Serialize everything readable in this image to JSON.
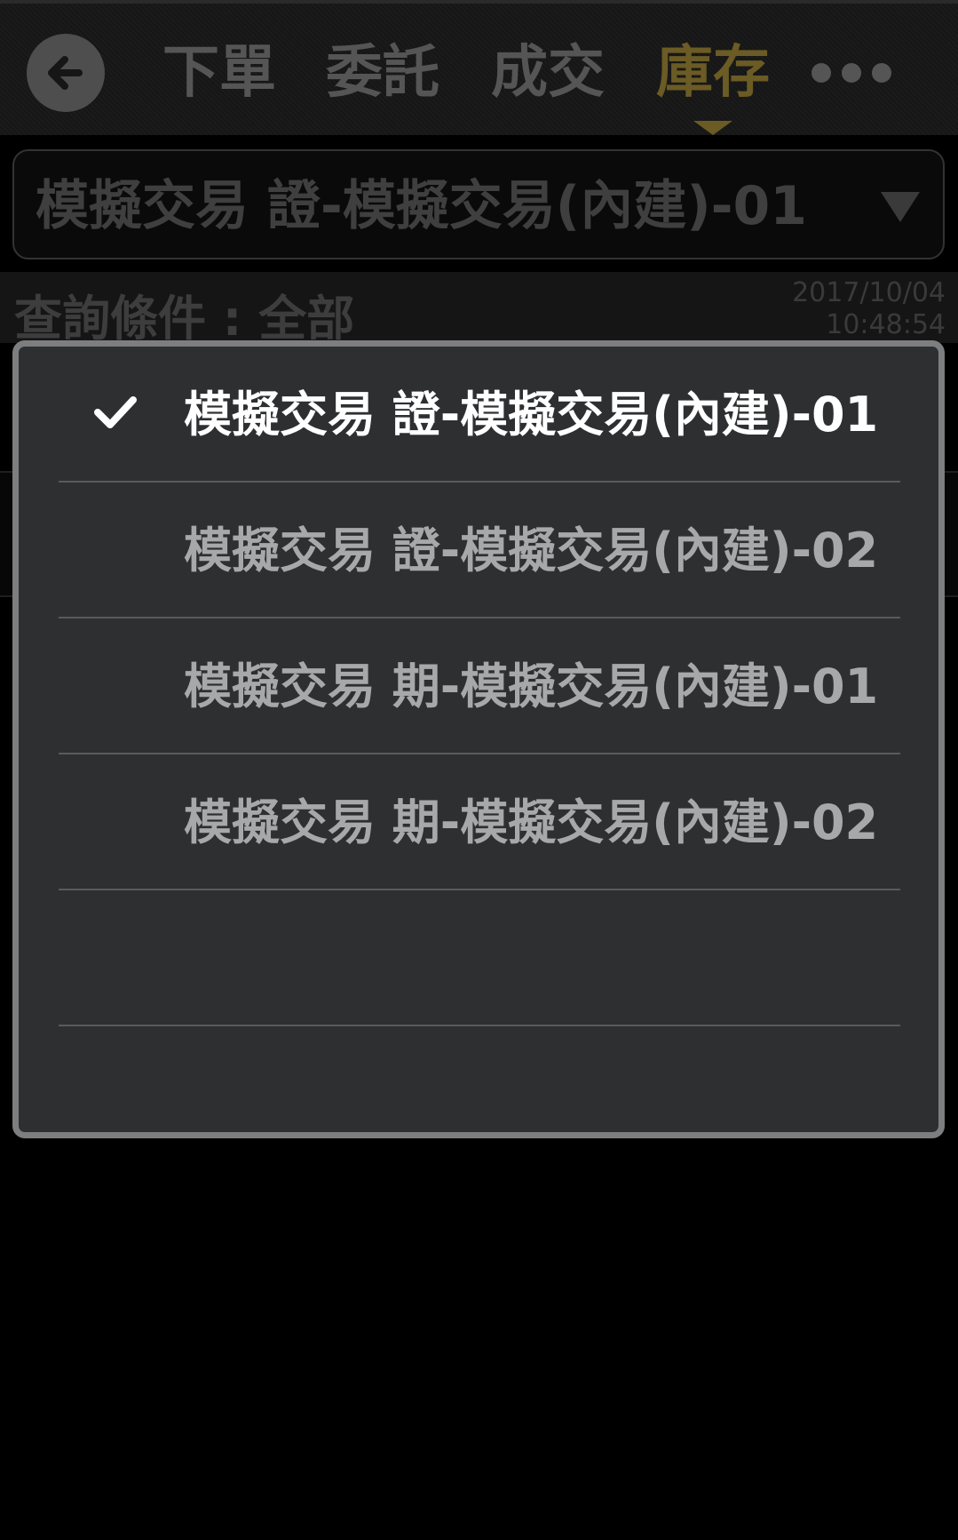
{
  "header": {
    "tabs": [
      {
        "label": "下單",
        "active": false
      },
      {
        "label": "委託",
        "active": false
      },
      {
        "label": "成交",
        "active": false
      },
      {
        "label": "庫存",
        "active": true
      }
    ]
  },
  "account_select": {
    "value": "模擬交易 證-模擬交易(內建)-01"
  },
  "query": {
    "label": "查詢條件 : 全部",
    "date": "2017/10/04",
    "time": "10:48:54"
  },
  "dialog": {
    "options": [
      {
        "label": "模擬交易 證-模擬交易(內建)-01",
        "selected": true
      },
      {
        "label": "模擬交易 證-模擬交易(內建)-02",
        "selected": false
      },
      {
        "label": "模擬交易 期-模擬交易(內建)-01",
        "selected": false
      },
      {
        "label": "模擬交易 期-模擬交易(內建)-02",
        "selected": false
      },
      {
        "label": "",
        "selected": false
      },
      {
        "label": "",
        "selected": false
      }
    ]
  },
  "colors": {
    "active_tab": "#6b5b24",
    "inactive_tab": "#555555",
    "dialog_bg": "#2e2f31",
    "dialog_border": "#7d7e80"
  },
  "icons": {
    "back": "arrow-left-icon",
    "more": "more-dots-icon",
    "check": "checkmark-icon",
    "caret": "caret-down-icon"
  }
}
